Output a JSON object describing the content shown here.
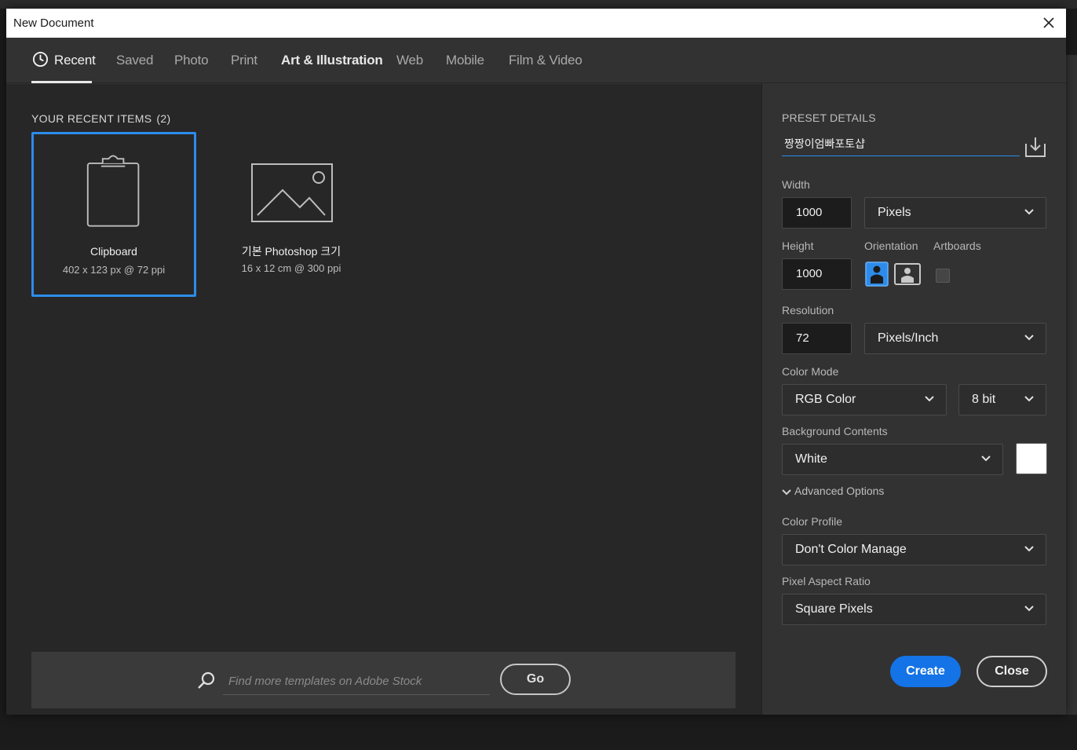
{
  "dialog": {
    "title": "New Document"
  },
  "tabs": [
    {
      "label": "Recent"
    },
    {
      "label": "Saved"
    },
    {
      "label": "Photo"
    },
    {
      "label": "Print"
    },
    {
      "label": "Art & Illustration"
    },
    {
      "label": "Web"
    },
    {
      "label": "Mobile"
    },
    {
      "label": "Film & Video"
    }
  ],
  "recent": {
    "heading": "YOUR RECENT ITEMS",
    "count": "(2)",
    "items": [
      {
        "name": "Clipboard",
        "meta": "402 x 123 px @ 72 ppi"
      },
      {
        "name": "기본 Photoshop 크기",
        "meta": "16 x 12 cm @ 300 ppi"
      }
    ]
  },
  "stock": {
    "placeholder": "Find more templates on Adobe Stock",
    "go_label": "Go"
  },
  "preset": {
    "heading": "PRESET DETAILS",
    "name": "짱짱이엄빠포토샵",
    "width_label": "Width",
    "width_value": "1000",
    "width_unit": "Pixels",
    "height_label": "Height",
    "height_value": "1000",
    "orientation_label": "Orientation",
    "artboards_label": "Artboards",
    "resolution_label": "Resolution",
    "resolution_value": "72",
    "resolution_unit": "Pixels/Inch",
    "color_mode_label": "Color Mode",
    "color_mode": "RGB Color",
    "bit_depth": "8 bit",
    "background_label": "Background Contents",
    "background": "White",
    "advanced_label": "Advanced Options",
    "color_profile_label": "Color Profile",
    "color_profile": "Don't Color Manage",
    "pixel_aspect_label": "Pixel Aspect Ratio",
    "pixel_aspect": "Square Pixels"
  },
  "actions": {
    "create_label": "Create",
    "close_label": "Close"
  },
  "colors": {
    "accent": "#1473e6",
    "selection": "#2d8ceb",
    "background_swatch": "#ffffff"
  }
}
